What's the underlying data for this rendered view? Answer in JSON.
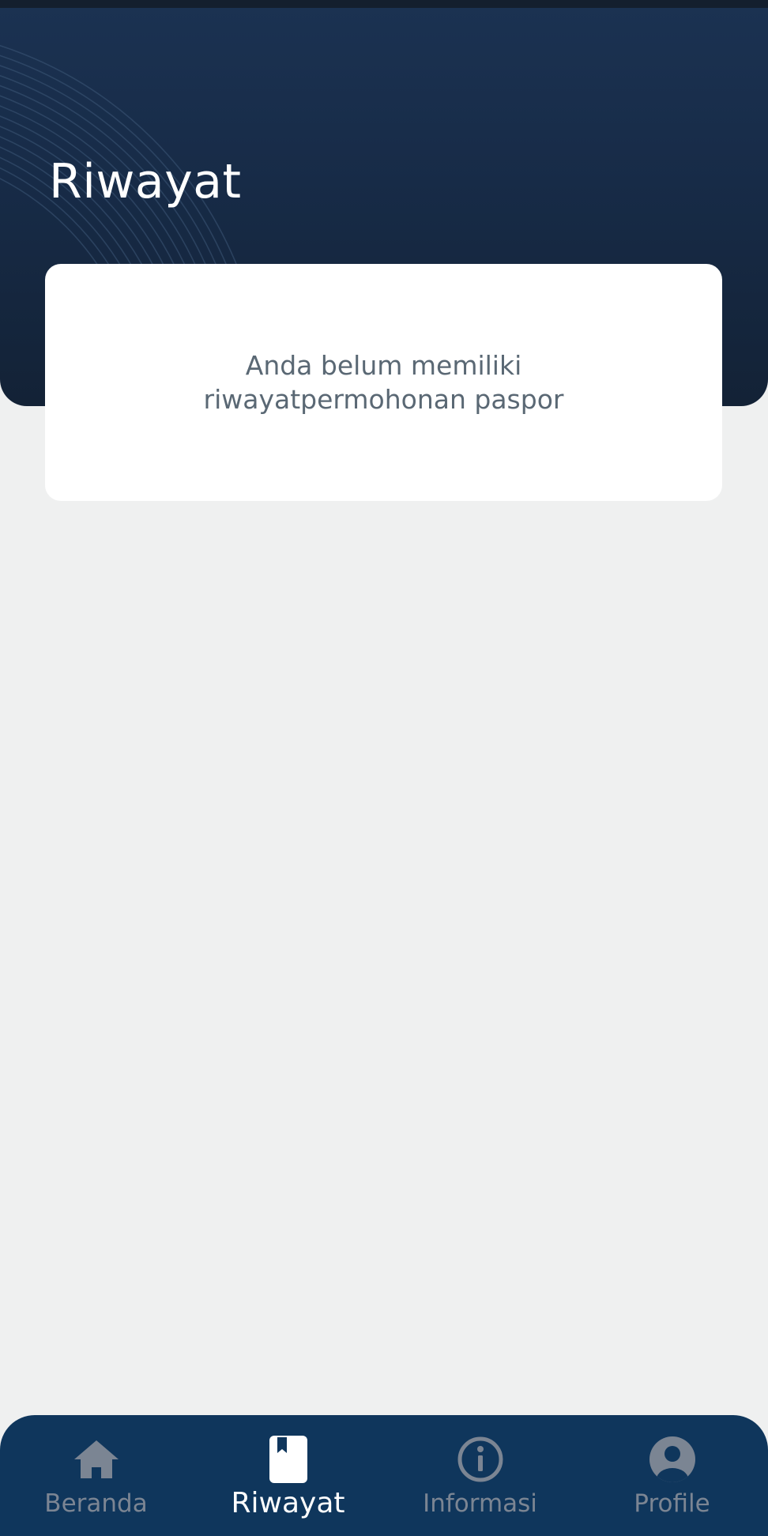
{
  "header": {
    "title": "Riwayat"
  },
  "empty_state": {
    "message_line1": "Anda belum memiliki",
    "message_line2": "riwayatpermohonan paspor"
  },
  "bottom_nav": {
    "active_index": 1,
    "items": [
      {
        "label": "Beranda",
        "icon": "home-icon"
      },
      {
        "label": "Riwayat",
        "icon": "bookmark-book-icon"
      },
      {
        "label": "Informasi",
        "icon": "info-circle-icon"
      },
      {
        "label": "Profile",
        "icon": "user-circle-icon"
      }
    ]
  },
  "colors": {
    "header_background": "#172b47",
    "page_background": "#eff0f0",
    "nav_background": "#0f365c",
    "nav_inactive": "#7b8593",
    "nav_active": "#ffffff",
    "message_text": "#5a6874"
  }
}
